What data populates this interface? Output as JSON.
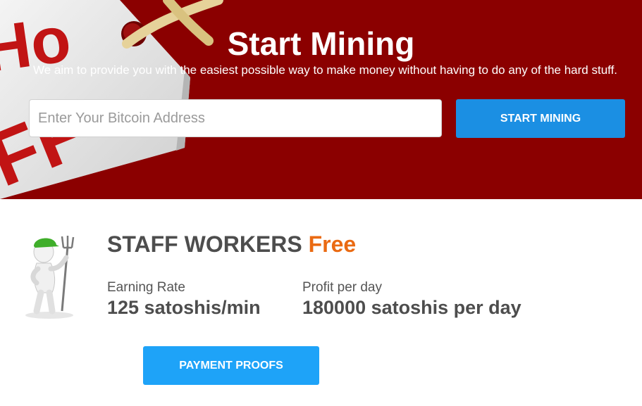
{
  "hero": {
    "title": "Start Mining",
    "subtitle": "We aim to provide you with the easiest possible way to make money without having to do any of the hard stuff.",
    "background_color": "#8b0000",
    "tag_lettering": "Ho FF"
  },
  "form": {
    "address_placeholder": "Enter Your Bitcoin Address",
    "address_value": "",
    "start_button_label": "START MINING",
    "start_button_color": "#1b8fe3"
  },
  "plan": {
    "title": "STAFF WORKERS",
    "badge": "Free",
    "badge_color": "#ea6a12",
    "icon": "stick-figure-farmer-with-pitchfork-icon",
    "earning_rate_label": "Earning Rate",
    "earning_rate_value": "125 satoshis/min",
    "profit_label": "Profit per day",
    "profit_value": "180000 satoshis per day"
  },
  "proofs": {
    "button_label": "PAYMENT PROOFS",
    "button_color": "#1ea3f8"
  }
}
